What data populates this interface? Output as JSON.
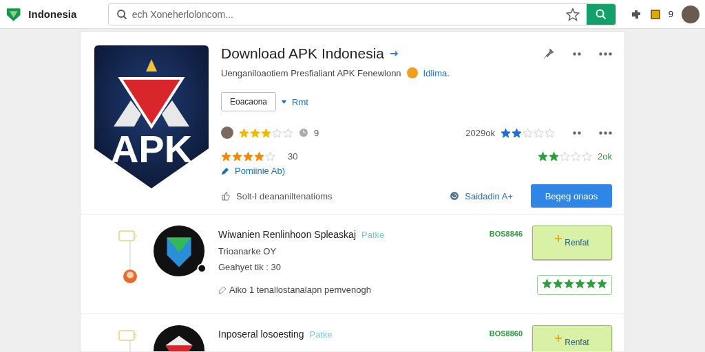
{
  "topbar": {
    "brand": "Indonesia",
    "search": {
      "placeholder": "ech Xoneherloloncom..."
    },
    "badge": "9"
  },
  "hero": {
    "logo_text": "APK",
    "title": "Download APK Indonesia",
    "subtitle": "Uenganiloaotiem Presfialiant APK Fenewlonn",
    "subtitle_link": "Idlima.",
    "outline_button": "Eoacaona",
    "edit_link": "Rmt",
    "rating_a": {
      "stars": 3,
      "count": "9"
    },
    "meta": "2029ok",
    "rating_b": {
      "stars": 2
    },
    "rating_c": {
      "stars": 4,
      "count": "30"
    },
    "rating_d": {
      "stars": 2,
      "count": "2ok"
    },
    "author_link": "Pomiinie Ab)",
    "note": "Solt-I deananiltenatioms",
    "secondary_link": "Saidadin A+",
    "primary_button": "Begeg onaos"
  },
  "apps": [
    {
      "name": "Wiwanien Renlinhoon Spleaskaj",
      "tag": "Patke",
      "developer": "Trioanarke OY",
      "meta": "Geahyet tik : 30",
      "note": "Aiko 1 tenallostanalapn pemvenogh",
      "code": "BOS8846",
      "button": "Renfat",
      "stars": 6,
      "kind": "shield"
    },
    {
      "name": "Inposeral losoesting",
      "tag": "Patke",
      "code": "BOS8860",
      "button": "Renfat",
      "kind": "gem"
    }
  ]
}
